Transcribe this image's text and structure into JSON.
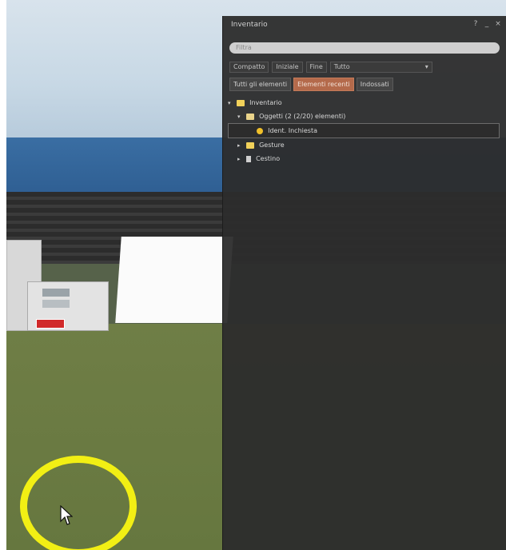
{
  "window": {
    "title": "Inventario",
    "controls": [
      "?",
      "_",
      "×"
    ]
  },
  "search": {
    "placeholder": "Filtra"
  },
  "filters": {
    "items": [
      "Compatto",
      "Iniziale",
      "Fine"
    ],
    "select_value": "Tutto",
    "select_arrow": "▾"
  },
  "tabs": [
    {
      "label": "Tutti gli elementi"
    },
    {
      "label": "Elementi recenti",
      "active": true
    },
    {
      "label": "Indossati"
    }
  ],
  "tree": [
    {
      "label": "Inventario",
      "expander": "▾",
      "icon": "folder-icon",
      "indent": 0
    },
    {
      "label": "Oggetti (2 (2/20) elementi)",
      "expander": "▾",
      "icon": "object-folder-icon",
      "indent": 1
    },
    {
      "label": "Ident. Inchiesta",
      "expander": "",
      "icon": "gesture-icon",
      "indent": 2,
      "selected": true
    },
    {
      "label": "Gesture",
      "expander": "▸",
      "icon": "gesture-folder-icon",
      "indent": 1
    },
    {
      "label": "Cestino",
      "expander": "▸",
      "icon": "trash-icon",
      "indent": 1
    }
  ],
  "colors": {
    "floater_bg": "#2c2c2c",
    "active_tab": "#b46a4b",
    "highlight_ring": "#f2ef14"
  }
}
